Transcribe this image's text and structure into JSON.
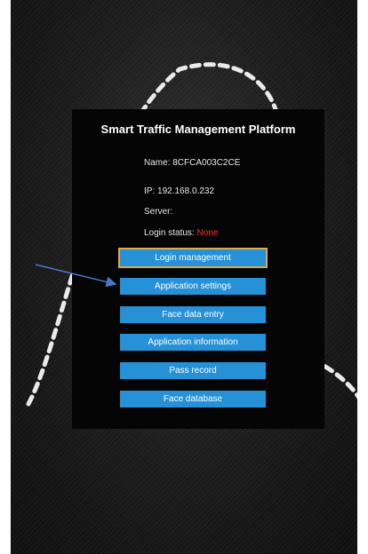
{
  "panel": {
    "title": "Smart Traffic Management Platform",
    "name_label": "Name: ",
    "name_value": "8CFCA003C2CE",
    "ip_label": "IP: ",
    "ip_value": "192.168.0.232",
    "server_label": "Server:",
    "server_value": "",
    "login_status_label": "Login status: ",
    "login_status_value": "None"
  },
  "menu": [
    {
      "label": "Login management",
      "selected": true
    },
    {
      "label": "Application settings",
      "selected": false
    },
    {
      "label": "Face data entry",
      "selected": false
    },
    {
      "label": "Application information",
      "selected": false
    },
    {
      "label": "Pass record",
      "selected": false
    },
    {
      "label": "Face database",
      "selected": false
    }
  ],
  "colors": {
    "button": "#2691d6",
    "selected_outline": "#e0a94a",
    "status_none": "#ff2a2a",
    "annotation_arrow": "#4a78c8"
  }
}
